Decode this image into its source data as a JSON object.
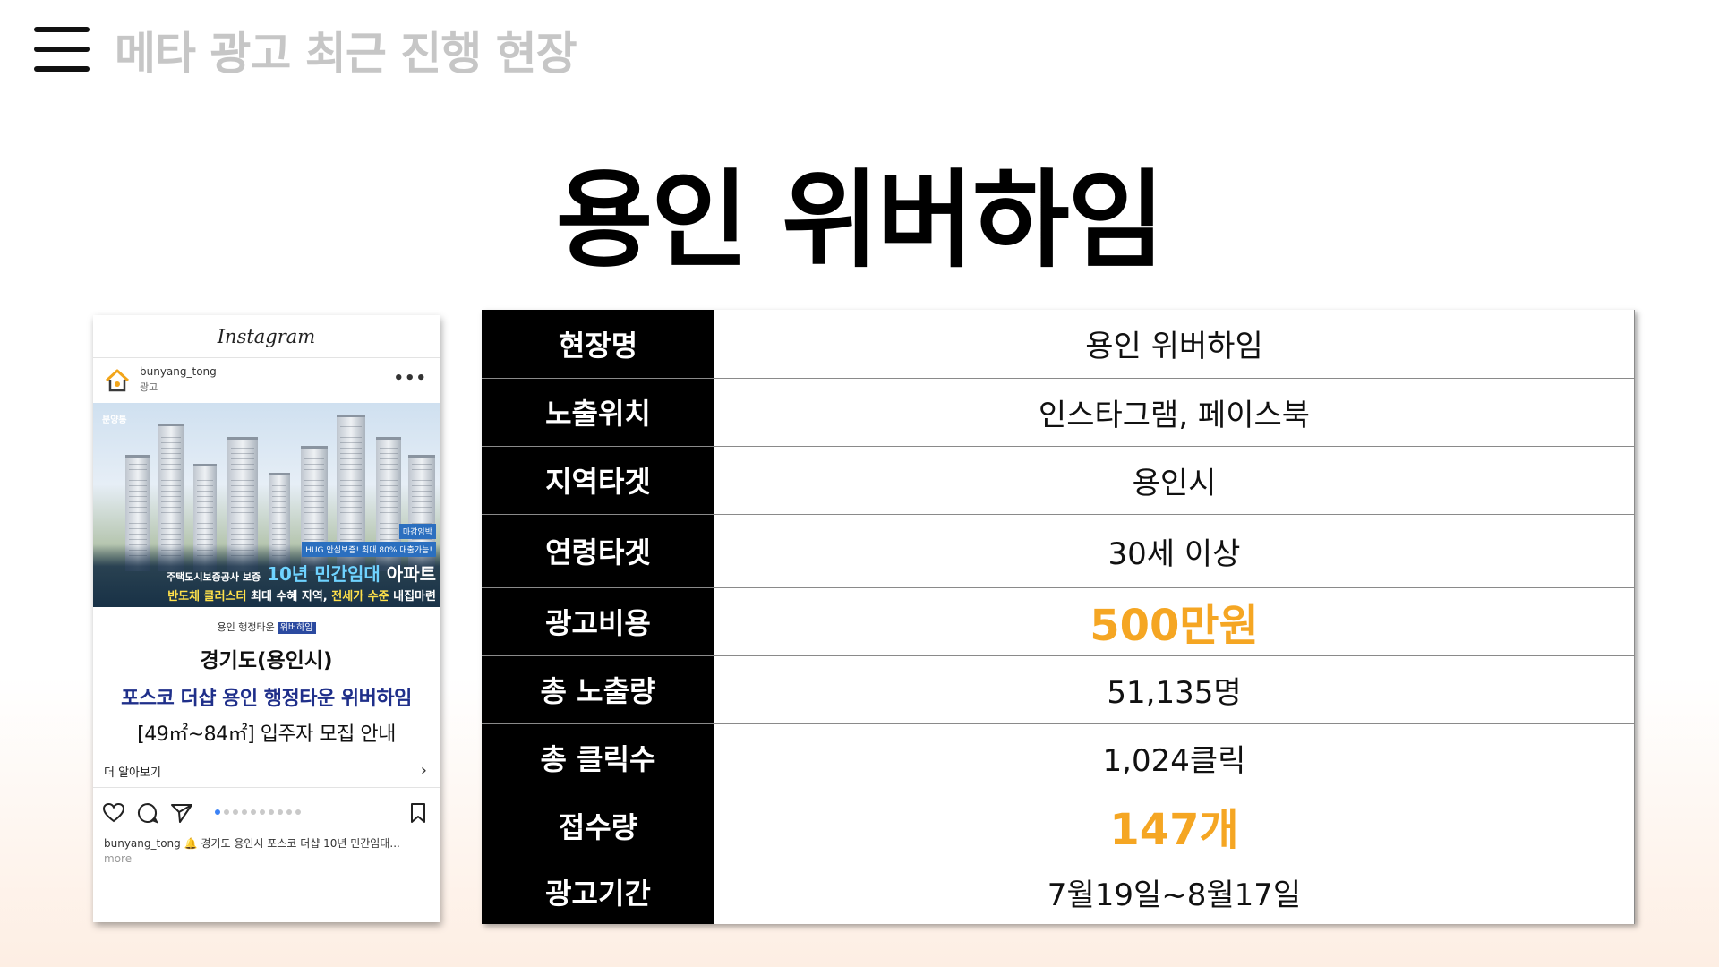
{
  "header": {
    "title": "메타 광고 최근 진행 현장"
  },
  "main": {
    "title": "용인 위버하임"
  },
  "instagram": {
    "app_name": "Instagram",
    "handle": "bunyang_tong",
    "sponsored": "광고",
    "image": {
      "logo": "분양통",
      "tag1": "마감임박",
      "tag2": "HUG 안심보증! 최대 80% 대출가능!",
      "line1_prefix": "주택도시보증공사 보증",
      "line1_highlight": "10년 민간임대",
      "line1_suffix": "아파트",
      "line2_yellow1": "반도체 클러스터",
      "line2_white": "최대 수혜 지역,",
      "line2_yellow2": "전세가 수준",
      "line2_end": "내집마련"
    },
    "caption": {
      "small": "용인 행정타운",
      "small_badge": "위버하임",
      "line1": "경기도(용인시)",
      "line2": "포스코 더샵 용인 행정타운 위버하임",
      "line3": "[49㎡~84㎡] 입주자 모집 안내"
    },
    "learn_more": "더 알아보기",
    "post_text": "경기도 용인시 포스코 더샵 10년 민간임대...",
    "more": "more"
  },
  "info_table": {
    "rows": [
      {
        "label": "현장명",
        "value": "용인 위버하임",
        "accent": false
      },
      {
        "label": "노출위치",
        "value": "인스타그램, 페이스북",
        "accent": false
      },
      {
        "label": "지역타겟",
        "value": "용인시",
        "accent": false
      },
      {
        "label": "연령타겟",
        "value": "30세 이상",
        "accent": false
      },
      {
        "label": "광고비용",
        "value": "500만원",
        "accent": true
      },
      {
        "label": "총 노출량",
        "value": "51,135명",
        "accent": false
      },
      {
        "label": "총 클릭수",
        "value": "1,024클릭",
        "accent": false
      },
      {
        "label": "접수량",
        "value": "147개",
        "accent": true
      },
      {
        "label": "광고기간",
        "value": "7월19일~8월17일",
        "accent": false
      }
    ]
  },
  "colors": {
    "accent": "#f5a623",
    "label_bg": "#000000",
    "header_gray": "#c6c6c6",
    "caption_blue": "#1f2f8a"
  }
}
